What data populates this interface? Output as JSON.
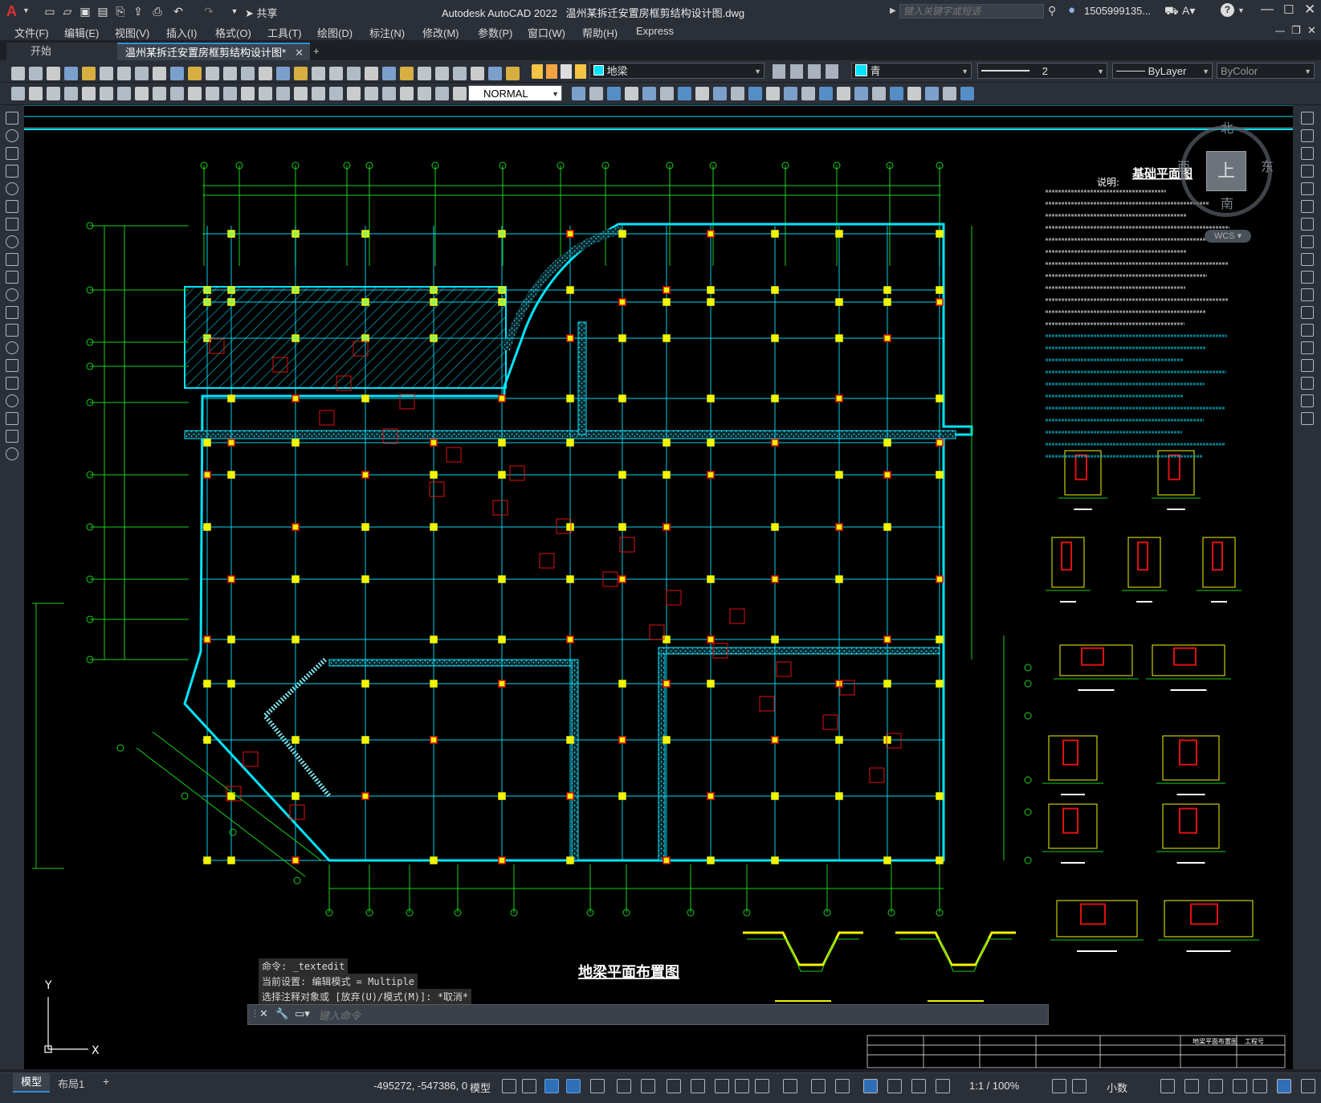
{
  "app": {
    "title": "Autodesk AutoCAD 2022",
    "filename": "温州某拆迁安置房框剪结构设计图.dwg",
    "share_label": "共享",
    "search_placeholder": "键入关键字或短语",
    "user": "1505999135..."
  },
  "menu": [
    "文件(F)",
    "编辑(E)",
    "视图(V)",
    "插入(I)",
    "格式(O)",
    "工具(T)",
    "绘图(D)",
    "标注(N)",
    "修改(M)",
    "参数(P)",
    "窗口(W)",
    "帮助(H)",
    "Express"
  ],
  "tabs": {
    "start": "开始",
    "active": "温州某拆迁安置房框剪结构设计图*",
    "add": "+"
  },
  "toolbar": {
    "layer": "地梁",
    "color": "青",
    "linetype_weight": "2",
    "linetype": "ByLayer",
    "plotstyle": "ByColor",
    "text_style": "NORMAL"
  },
  "viewcube": {
    "north": "北",
    "south": "南",
    "east": "东",
    "west": "西",
    "face": "上",
    "wcs": "WCS"
  },
  "drawing": {
    "plan_title": "地梁平面布置图",
    "base_plan_title": "基础平面图",
    "notes_heading": "说明:",
    "title_block_name": "地梁平面布置图",
    "title_block_no": "工程号"
  },
  "command": {
    "history": [
      "命令: _textedit",
      "当前设置: 编辑模式 = Multiple",
      "选择注释对象或 [放弃(U)/模式(M)]: *取消*"
    ],
    "prompt_placeholder": "键入命令"
  },
  "layout_tabs": [
    "模型",
    "布局1",
    "+"
  ],
  "status": {
    "coords": "-495272, -547386, 0",
    "space": "模型",
    "scale": "1:1 / 100%",
    "units": "小数"
  },
  "colors": {
    "cyan": "#00e5ff",
    "green": "#19d119",
    "yellow": "#f4f400",
    "red": "#e01010",
    "white": "#ffffff"
  }
}
